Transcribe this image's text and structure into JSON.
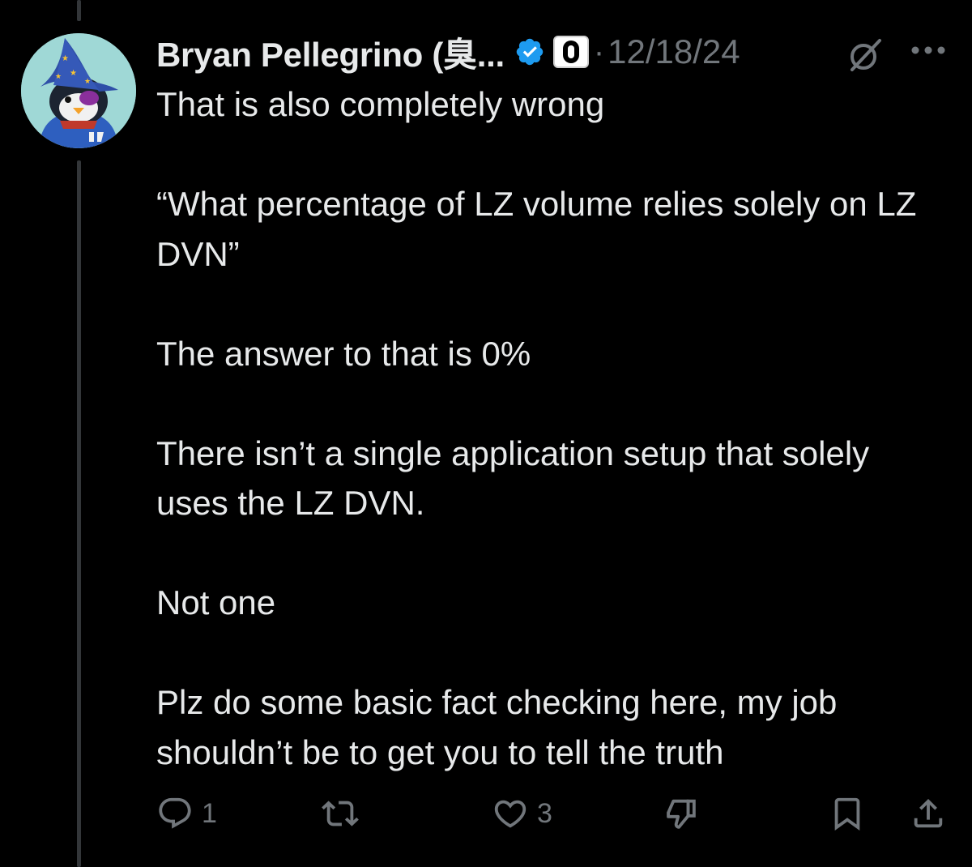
{
  "post": {
    "author_name": "Bryan Pellegrino (臭...",
    "separator": "·",
    "timestamp": "12/18/24",
    "body": {
      "line1": "That is also completely wrong",
      "line2": "“What percentage of LZ volume relies solely on LZ DVN”",
      "line3": "The answer to that is 0%",
      "line4": "There isn’t a single application setup that solely uses the LZ DVN.",
      "line5": "Not one",
      "line6": "Plz do some basic fact checking here, my job shouldn’t be to get you to tell the truth"
    }
  },
  "actions": {
    "reply_count": "1",
    "repost_count": "",
    "like_count": "3"
  },
  "icons": {
    "verified": "verified-badge-icon",
    "affiliate": "affiliate-badge-icon",
    "grok": "grok-icon",
    "more": "more-icon",
    "reply": "reply-icon",
    "repost": "repost-icon",
    "like": "heart-icon",
    "dislike": "thumbs-down-icon",
    "bookmark": "bookmark-icon",
    "share": "share-icon"
  },
  "colors": {
    "background": "#000000",
    "text": "#e7e9ea",
    "muted": "#71767b",
    "verified": "#1d9bf0",
    "thread_line": "#333639"
  }
}
